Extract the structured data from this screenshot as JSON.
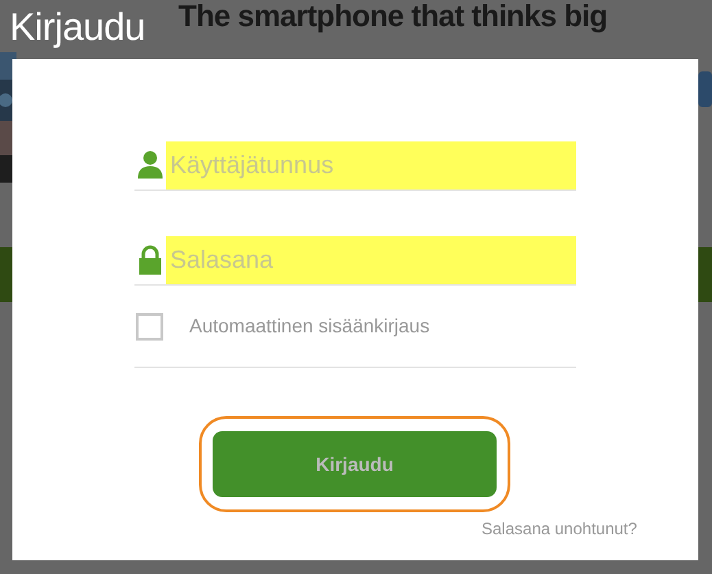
{
  "background_page": {
    "headline": "The smartphone that thinks big"
  },
  "dialog": {
    "title": "Kirjaudu",
    "fields": [
      {
        "kind": "username",
        "placeholder": "Käyttäjätunnus",
        "autofilled": true
      },
      {
        "kind": "password",
        "placeholder": "Salasana",
        "autofilled": true
      }
    ],
    "remember": {
      "label": "Automaattinen sisäänkirjaus",
      "checked": false
    },
    "submit": {
      "label": "Kirjaudu",
      "focused": true
    },
    "forgot_link": "Salasana unohtunut?"
  }
}
